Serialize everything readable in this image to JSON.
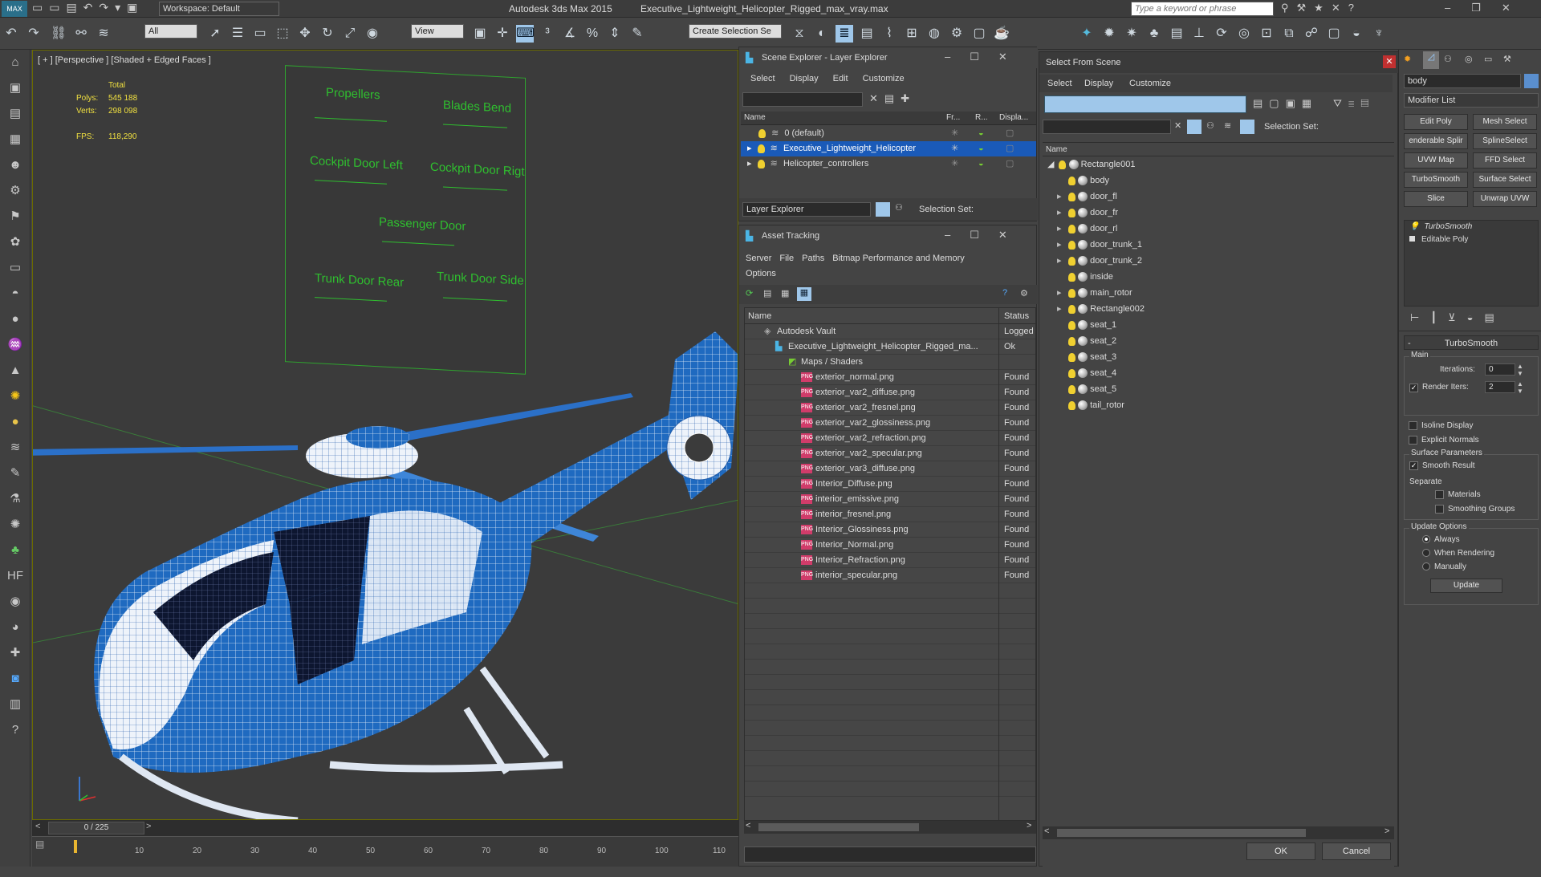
{
  "app": {
    "title": "Autodesk 3ds Max  2015",
    "file": "Executive_Lightweight_Helicopter_Rigged_max_vray.max",
    "workspace": "Workspace: Default",
    "search_placeholder": "Type a keyword or phrase",
    "selection_filter": "All",
    "ref_coord": "View",
    "named_sel": "Create Selection Se"
  },
  "viewport": {
    "label": "[ + ] [Perspective ] [Shaded + Edged Faces ]",
    "stats": {
      "total_label": "Total",
      "polys_label": "Polys:",
      "polys_value": "545 188",
      "verts_label": "Verts:",
      "verts_value": "298 098",
      "fps_label": "FPS:",
      "fps_value": "118,290"
    },
    "controls": [
      "Propellers",
      "Blades Bend",
      "Cockpit Door Left",
      "Cockpit Door Rigt",
      "Passenger Door",
      "Trunk Door Rear",
      "Trunk Door Side"
    ]
  },
  "timeline": {
    "frame": "0 / 225",
    "ticks": [
      "10",
      "20",
      "30",
      "40",
      "50",
      "60",
      "70",
      "80",
      "90",
      "100",
      "110"
    ]
  },
  "scene_explorer": {
    "title": "Scene Explorer - Layer Explorer",
    "menu": [
      "Select",
      "Display",
      "Edit",
      "Customize"
    ],
    "columns": [
      "Name",
      "Fr...",
      "R...",
      "Displa..."
    ],
    "rows": [
      {
        "name": "0 (default)",
        "selected": false
      },
      {
        "name": "Executive_Lightweight_Helicopter",
        "selected": true
      },
      {
        "name": "Helicopter_controllers",
        "selected": false
      }
    ],
    "footer_dropdown": "Layer Explorer",
    "selection_set_label": "Selection Set:"
  },
  "asset_tracking": {
    "title": "Asset Tracking",
    "menu": [
      "Server",
      "File",
      "Paths",
      "Bitmap Performance and Memory",
      "Options"
    ],
    "columns": [
      "Name",
      "Status"
    ],
    "vault": {
      "name": "Autodesk Vault",
      "status": "Logged"
    },
    "file": {
      "name": "Executive_Lightweight_Helicopter_Rigged_ma...",
      "status": "Ok"
    },
    "group": {
      "name": "Maps / Shaders"
    },
    "maps": [
      {
        "name": "exterior_normal.png",
        "status": "Found"
      },
      {
        "name": "exterior_var2_diffuse.png",
        "status": "Found"
      },
      {
        "name": "exterior_var2_fresnel.png",
        "status": "Found"
      },
      {
        "name": "exterior_var2_glossiness.png",
        "status": "Found"
      },
      {
        "name": "exterior_var2_refraction.png",
        "status": "Found"
      },
      {
        "name": "exterior_var2_specular.png",
        "status": "Found"
      },
      {
        "name": "exterior_var3_diffuse.png",
        "status": "Found"
      },
      {
        "name": "Interior_Diffuse.png",
        "status": "Found"
      },
      {
        "name": "interior_emissive.png",
        "status": "Found"
      },
      {
        "name": "interior_fresnel.png",
        "status": "Found"
      },
      {
        "name": "Interior_Glossiness.png",
        "status": "Found"
      },
      {
        "name": "Interior_Normal.png",
        "status": "Found"
      },
      {
        "name": "Interior_Refraction.png",
        "status": "Found"
      },
      {
        "name": "interior_specular.png",
        "status": "Found"
      }
    ]
  },
  "select_from_scene": {
    "title": "Select From Scene",
    "menu": [
      "Select",
      "Display",
      "Customize"
    ],
    "selection_set_label": "Selection Set:",
    "name_header": "Name",
    "root": "Rectangle001",
    "children": [
      {
        "name": "body",
        "expandable": false
      },
      {
        "name": "door_fl",
        "expandable": true
      },
      {
        "name": "door_fr",
        "expandable": true
      },
      {
        "name": "door_rl",
        "expandable": true
      },
      {
        "name": "door_trunk_1",
        "expandable": true
      },
      {
        "name": "door_trunk_2",
        "expandable": true
      },
      {
        "name": "inside",
        "expandable": false
      },
      {
        "name": "main_rotor",
        "expandable": true
      },
      {
        "name": "Rectangle002",
        "expandable": true
      },
      {
        "name": "seat_1",
        "expandable": false
      },
      {
        "name": "seat_2",
        "expandable": false
      },
      {
        "name": "seat_3",
        "expandable": false
      },
      {
        "name": "seat_4",
        "expandable": false
      },
      {
        "name": "seat_5",
        "expandable": false
      },
      {
        "name": "tail_rotor",
        "expandable": false
      }
    ],
    "ok": "OK",
    "cancel": "Cancel"
  },
  "command_panel": {
    "object_name": "body",
    "modifier_list": "Modifier List",
    "buttons": [
      "Edit Poly",
      "Mesh Select",
      "enderable Splir",
      "SplineSelect",
      "UVW Map",
      "FFD Select",
      "TurboSmooth",
      "Surface Select",
      "Slice",
      "Unwrap UVW"
    ],
    "stack": [
      "TurboSmooth",
      "Editable Poly"
    ],
    "rollout_title": "TurboSmooth",
    "main_label": "Main",
    "iterations_label": "Iterations:",
    "iterations_value": "0",
    "render_iters_label": "Render Iters:",
    "render_iters_value": "2",
    "isoline": "Isoline Display",
    "explicit_normals": "Explicit Normals",
    "surface_params": "Surface Parameters",
    "smooth_result": "Smooth Result",
    "separate": "Separate",
    "materials": "Materials",
    "smoothing_groups": "Smoothing Groups",
    "update_options": "Update Options",
    "always": "Always",
    "when_rendering": "When Rendering",
    "manually": "Manually",
    "update_button": "Update"
  }
}
